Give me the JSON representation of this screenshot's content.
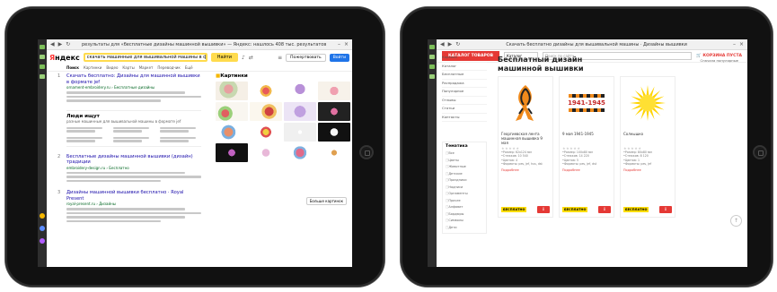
{
  "left_tablet": {
    "browser_title": "результаты для «бесплатные дизайны машинной вышивки» — Яндекс: нашлось 408 тыс. результатов",
    "yandex": {
      "logo_prefix": "Я",
      "logo_suffix": "ндекс",
      "search_value": "скачать машинные для вышивальной машины в формате jef",
      "find_label": "Найти",
      "pill_label": "Пожертвовать",
      "login_label": "Войти",
      "tabs": [
        "Поиск",
        "Картинки",
        "Видео",
        "Карты",
        "Маркет",
        "Переводчик",
        "Ещё"
      ],
      "results": [
        {
          "num": "1",
          "title": "Скачать бесплатно: Дизайны для машинной вышивки в формате jef",
          "url": "ornament-embroidery.ru › Бесплатные дизайны"
        },
        {
          "num": "2",
          "title": "Бесплатные дизайны машинной вышивки (дизайн) традиции",
          "url": "embroidery-design.ru › Бесплатно"
        },
        {
          "num": "3",
          "title": "Дизайны машинной вышивки бесплатно · Royal Present",
          "url": "royal-present.ru › Дизайны"
        }
      ],
      "people": {
        "title": "Люди ищут",
        "subtitle": "разные машинные для вышивальной машины в формате jef"
      },
      "images_title": "Картинки",
      "more_images": "Больше картинок"
    }
  },
  "right_tablet": {
    "browser_title": "Скачать бесплатно дизайны для вышивальной машины · Дизайны вышивки",
    "shop": {
      "catalog_label": "КАТАЛОГ ТОВАРОВ",
      "select_label": "Каталог",
      "search_placeholder": "Поиск по сайту",
      "cart_label": "КОРЗИНА ПУСТА",
      "sidebar": [
        "Корзина",
        "Каталог",
        "Бесплатные",
        "Распродажа",
        "Популярное",
        "Отзывы",
        "Статьи",
        "Контакты"
      ],
      "filter_title": "Тематика",
      "filters": [
        "Все",
        "Цветы",
        "Животные",
        "Детские",
        "Праздники",
        "Надписи",
        "Орнаменты",
        "Прочее",
        "Алфавит",
        "Бордюры",
        "Символы",
        "Дети"
      ],
      "page_title": "Бесплатный дизайн машинной вышивки",
      "sort_label": "Сначала популярные",
      "products": [
        {
          "name": "Георгиевская лента машинная вышивка 9 мая",
          "stars": "★★★★★",
          "specs": [
            "Размер: 62x124 мм",
            "Стежков: 10 540",
            "Цветов: 4",
            "Форматы: pes, jef, hus, dst"
          ],
          "link": "Подробнее",
          "free_label": "БЕСПЛАТНО",
          "dl": "⇓",
          "art": "ribbon"
        },
        {
          "name": "9 мая 1941-1945",
          "stars": "★★★★★",
          "specs": [
            "Размер: 100x80 мм",
            "Стежков: 14 220",
            "Цветов: 5",
            "Форматы: pes, jef, dst"
          ],
          "link": "Подробнее",
          "free_label": "БЕСПЛАТНО",
          "dl": "⇓",
          "art": "victory",
          "art_text": "1941-1945"
        },
        {
          "name": "Солнышко",
          "stars": "★★★★★",
          "specs": [
            "Размер: 80x80 мм",
            "Стежков: 8 120",
            "Цветов: 1",
            "Форматы: pes, jef"
          ],
          "link": "Подробнее",
          "free_label": "БЕСПЛАТНО",
          "dl": "⇓",
          "art": "sun"
        }
      ]
    }
  },
  "colors": {
    "yandex_yellow": "#ffdb4d",
    "shop_red": "#e53935",
    "free_yellow": "#ffde00",
    "link_blue": "#1a0dab"
  }
}
